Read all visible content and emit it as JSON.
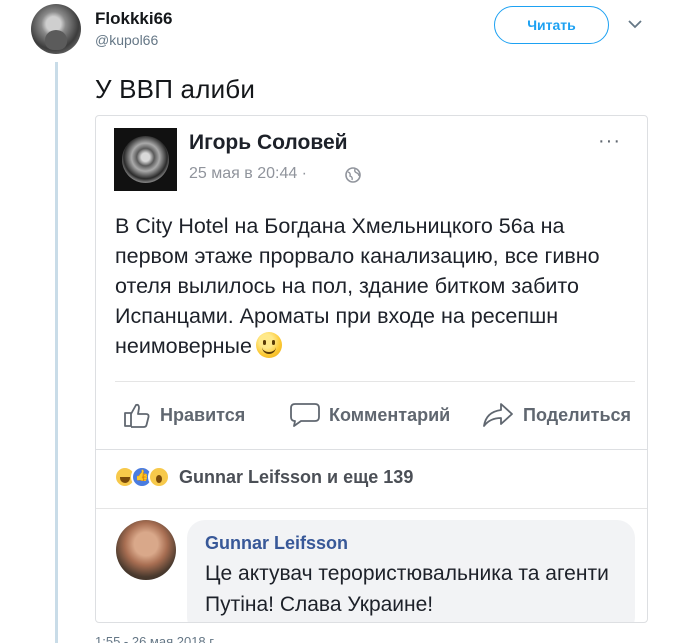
{
  "tweet": {
    "author_name": "Flokkki66",
    "author_handle": "@kupol66",
    "follow_label": "Читать",
    "text": "У ВВП алиби",
    "date": "1:55 - 26 мая 2018 г."
  },
  "fb_post": {
    "author": "Игорь Соловей",
    "timestamp": "25 мая в 20:44 ·",
    "more_label": "···",
    "text": "В City Hotel на Богдана Хмельницкого 56а на первом этаже прорвало канализацию, все гивно отеля вылилось на пол, здание битком забито Испанцами.  Ароматы при входе на ресепшн неимоверные",
    "actions": {
      "like": "Нравится",
      "comment": "Комментарий",
      "share": "Поделиться"
    },
    "reactions_text": "Gunnar Leifsson и еще 139",
    "comment": {
      "author": "Gunnar Leifsson",
      "text": "Це актувач терористювальника та агенти Путіна! Слава Украине!"
    }
  },
  "colors": {
    "twitter_blue": "#1da1f2",
    "fb_link": "#385898",
    "thread_line": "#c9dce8"
  }
}
